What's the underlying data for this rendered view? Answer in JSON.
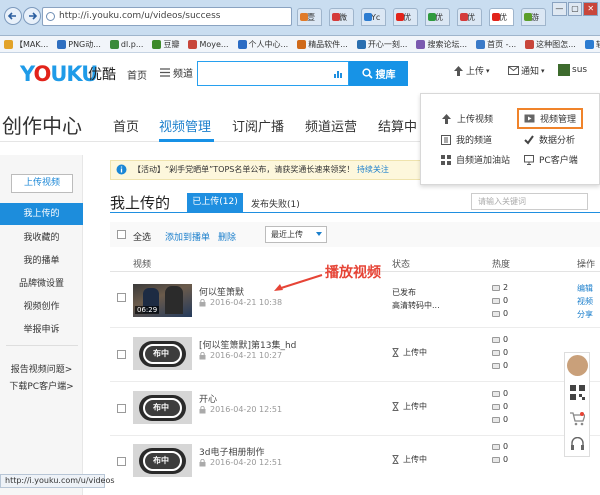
{
  "browser": {
    "url": "http://i.youku.com/u/videos/success",
    "tabs": [
      {
        "label": "壹",
        "color": "#e07b2a"
      },
      {
        "label": "微",
        "color": "#d43b3b"
      },
      {
        "label": "Yc",
        "color": "#2c7cd1"
      },
      {
        "label": "优",
        "color": "#e2231a"
      },
      {
        "label": "优",
        "color": "#2f9a3e"
      },
      {
        "label": "优",
        "color": "#d43b3b"
      },
      {
        "label": "优",
        "color": "#e2231a"
      },
      {
        "label": "游",
        "color": "#5b9e2a"
      }
    ],
    "window_buttons": [
      "—",
      "▢",
      "✕"
    ],
    "favorites": [
      "【MAK...",
      "PNG动...",
      "dl.p...",
      "豆瓣",
      "Moye...",
      "个人中心...",
      "精品软件...",
      "开心一刻...",
      "搜索论坛...",
      "首页 -...",
      "这种图怎...",
      "软件下载..."
    ],
    "status_url": "http://i.youku.com/u/videos"
  },
  "site": {
    "logo_text": "YOUKU",
    "logo_cn": "优酷",
    "nav_home": "首页",
    "nav_channel": "频道",
    "search_button": "搜库",
    "upload": "上传",
    "notice": "通知",
    "username": "sus"
  },
  "creator_nav": {
    "title": "创作中心",
    "items": [
      "首页",
      "视频管理",
      "订阅广播",
      "频道运营",
      "结算中"
    ]
  },
  "dropdown": {
    "items": [
      "上传视频",
      "视频管理",
      "我的频道",
      "数据分析",
      "自频道加油站",
      "PC客户端"
    ]
  },
  "sidebar": {
    "upload_button": "上传视频",
    "items": [
      "我上传的",
      "我收藏的",
      "我的播单",
      "品牌微设置",
      "视频创作",
      "举报申诉"
    ],
    "bottom_links": [
      "报告视频问题>",
      "下载PC客户端>"
    ]
  },
  "banner": {
    "text": "【活动】“剁手党晒单”TOPS名单公布，请获奖通长速来领奖！",
    "link": "持续关注"
  },
  "content": {
    "heading": "我上传的",
    "tab_uploaded": "已上传(12)",
    "tab_failed": "发布失败(1)",
    "filter_placeholder": "请输入关键词",
    "select_all": "全选",
    "add_to_playlist": "添加到播单",
    "delete": "删除",
    "sort": "最近上传",
    "columns": [
      "视频",
      "状态",
      "热度",
      "操作"
    ],
    "videos": [
      {
        "title": "何以笙箫默",
        "date": "2016-04-21 10:38",
        "duration": "06:29",
        "status": "已发布",
        "sub": "高清转码中...",
        "counts": [
          "2",
          "0",
          "0"
        ],
        "ops": [
          "编辑",
          "视频",
          "分享"
        ]
      },
      {
        "title": "[何以笙箫默]第13集_hd",
        "date": "2016-04-21 10:27",
        "badge": "布中",
        "status": "上传中",
        "counts": [
          "0",
          "0",
          "0"
        ]
      },
      {
        "title": "开心",
        "date": "2016-04-20 12:51",
        "badge": "布中",
        "status": "上传中",
        "counts": [
          "0",
          "0",
          "0"
        ]
      },
      {
        "title": "3d电子相册制作",
        "date": "2016-04-20 12:51",
        "badge": "布中",
        "status": "上传中",
        "counts": [
          "0",
          "0"
        ]
      }
    ]
  },
  "annotation": "播放视频"
}
